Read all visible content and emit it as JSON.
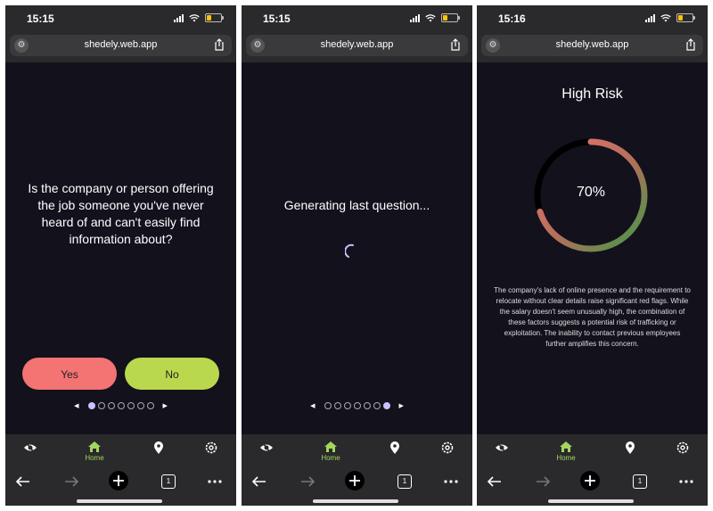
{
  "screens": [
    {
      "time": "15:15",
      "url": "shedely.web.app",
      "question": "Is the company or person offering the job someone you've never heard of and can't easily find information about?",
      "yes_label": "Yes",
      "no_label": "No",
      "pager": {
        "total": 7,
        "active": 1
      },
      "nav_home_label": "Home",
      "tab_count": "1"
    },
    {
      "time": "15:15",
      "url": "shedely.web.app",
      "status_text": "Generating last question...",
      "pager": {
        "total": 7,
        "active": 7
      },
      "nav_home_label": "Home",
      "tab_count": "1"
    },
    {
      "time": "15:16",
      "url": "shedely.web.app",
      "risk_title": "High Risk",
      "risk_percent": "70%",
      "risk_value": 0.7,
      "explanation": "The company's lack of online presence and the requirement to relocate without clear details raise significant red flags. While the salary doesn't seem unusually high, the combination of these factors suggests a potential risk of trafficking or exploitation. The inability to contact previous employees further amplifies this concern.",
      "nav_home_label": "Home",
      "tab_count": "1"
    }
  ],
  "colors": {
    "background": "#13111c",
    "yes_button": "#f47373",
    "no_button": "#bad84e",
    "accent_green": "#a4d65e",
    "pager_active": "#c7c3ff",
    "gauge_start": "#3d9a48",
    "gauge_end": "#f07070"
  },
  "icons": {
    "nav": [
      "eye-slash-icon",
      "home-icon",
      "location-pin-icon",
      "settings-gear-icon"
    ],
    "browser": [
      "back-arrow-icon",
      "forward-arrow-icon",
      "new-tab-plus-icon",
      "tabs-count-icon",
      "more-dots-icon"
    ]
  }
}
